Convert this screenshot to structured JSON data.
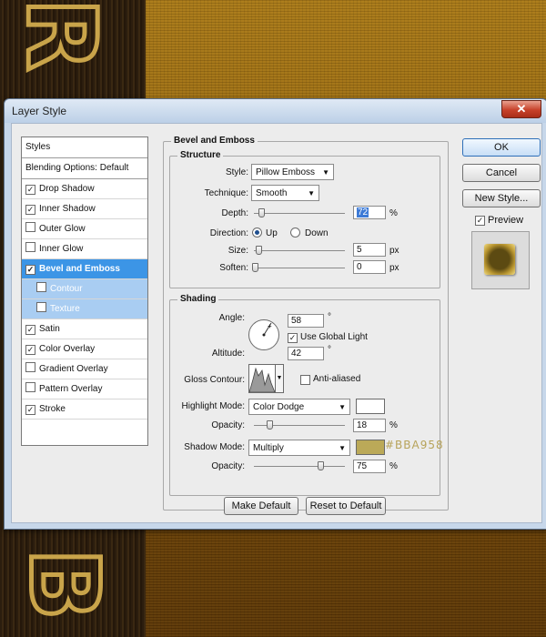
{
  "dialog": {
    "title": "Layer Style",
    "close_glyph": "✕"
  },
  "styles_list": {
    "header": "Styles",
    "blending": "Blending Options: Default",
    "items": [
      {
        "label": "Drop Shadow",
        "checked": true
      },
      {
        "label": "Inner Shadow",
        "checked": true
      },
      {
        "label": "Outer Glow",
        "checked": false
      },
      {
        "label": "Inner Glow",
        "checked": false
      },
      {
        "label": "Bevel and Emboss",
        "checked": true,
        "active": true
      },
      {
        "label": "Contour",
        "checked": false,
        "sub": true
      },
      {
        "label": "Texture",
        "checked": false,
        "sub": true
      },
      {
        "label": "Satin",
        "checked": true
      },
      {
        "label": "Color Overlay",
        "checked": true
      },
      {
        "label": "Gradient Overlay",
        "checked": false
      },
      {
        "label": "Pattern Overlay",
        "checked": false
      },
      {
        "label": "Stroke",
        "checked": true
      }
    ]
  },
  "bevel": {
    "section_title": "Bevel and Emboss",
    "structure": {
      "title": "Structure",
      "style_label": "Style:",
      "style_value": "Pillow Emboss",
      "technique_label": "Technique:",
      "technique_value": "Smooth",
      "depth_label": "Depth:",
      "depth_value": "72",
      "depth_unit": "%",
      "direction_label": "Direction:",
      "up_label": "Up",
      "down_label": "Down",
      "direction_selected": "Up",
      "size_label": "Size:",
      "size_value": "5",
      "size_unit": "px",
      "soften_label": "Soften:",
      "soften_value": "0",
      "soften_unit": "px"
    },
    "shading": {
      "title": "Shading",
      "angle_label": "Angle:",
      "angle_value": "58",
      "angle_unit": "°",
      "global_light_label": "Use Global Light",
      "global_light_checked": true,
      "altitude_label": "Altitude:",
      "altitude_value": "42",
      "altitude_unit": "°",
      "gloss_label": "Gloss Contour:",
      "antialiased_label": "Anti-aliased",
      "antialiased_checked": false,
      "highlight_mode_label": "Highlight Mode:",
      "highlight_mode_value": "Color Dodge",
      "highlight_color": "#ffffff",
      "highlight_opacity_label": "Opacity:",
      "highlight_opacity_value": "18",
      "highlight_opacity_unit": "%",
      "shadow_mode_label": "Shadow Mode:",
      "shadow_mode_value": "Multiply",
      "shadow_color": "#BBA958",
      "shadow_color_annotation": "#BBA958",
      "shadow_opacity_label": "Opacity:",
      "shadow_opacity_value": "75",
      "shadow_opacity_unit": "%"
    },
    "make_default": "Make Default",
    "reset_default": "Reset to Default"
  },
  "side_buttons": {
    "ok": "OK",
    "cancel": "Cancel",
    "new_style": "New Style...",
    "preview_label": "Preview",
    "preview_checked": true
  },
  "background": {
    "letters": [
      "R",
      "B"
    ]
  }
}
